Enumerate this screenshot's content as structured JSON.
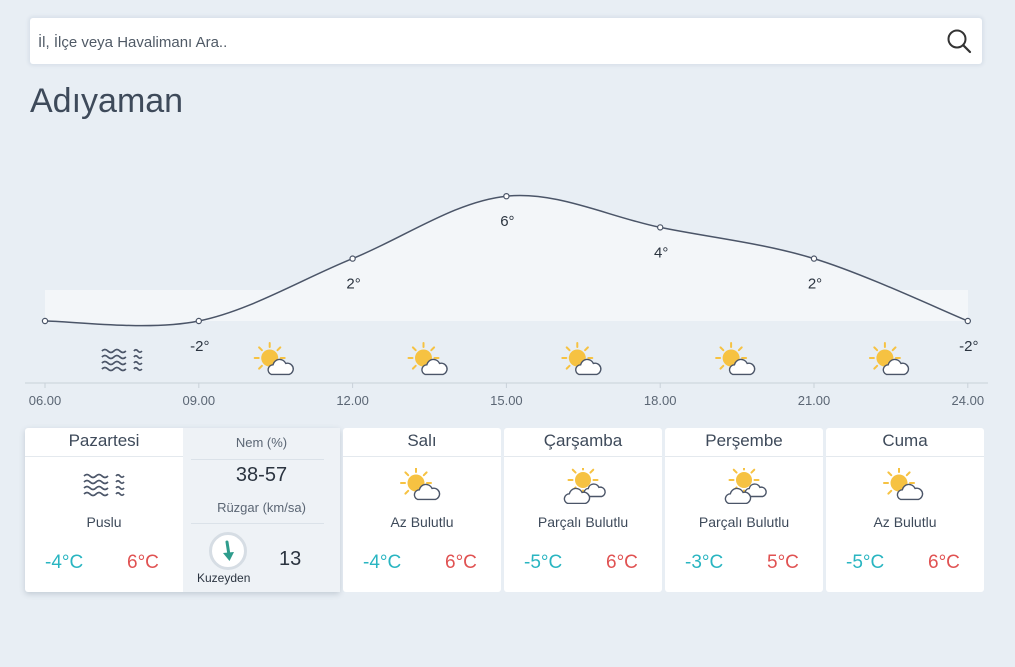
{
  "search": {
    "placeholder": "İl, İlçe veya Havalimanı Ara.."
  },
  "city": "Adıyaman",
  "chart_data": {
    "type": "line",
    "x": [
      "06.00",
      "09.00",
      "12.00",
      "15.00",
      "18.00",
      "21.00",
      "24.00"
    ],
    "values": [
      -2,
      -2,
      2,
      6,
      4,
      2,
      -2
    ],
    "value_labels": [
      "",
      "-2°",
      "2°",
      "6°",
      "4°",
      "2°",
      "-2°"
    ],
    "interval_icons": [
      "fog-icon",
      "partly-cloudy-icon",
      "partly-cloudy-icon",
      "partly-cloudy-icon",
      "partly-cloudy-icon",
      "partly-cloudy-icon"
    ],
    "colors": {
      "line": "#4b5568",
      "fill": "#f3f6f9",
      "sun": "#f6c242"
    }
  },
  "today": {
    "day": "Pazartesi",
    "icon": "fog-icon",
    "condition": "Puslu",
    "min": "-4°C",
    "max": "6°C",
    "humidity_label": "Nem (%)",
    "humidity": "38-57",
    "wind_label": "Rüzgar (km/sa)",
    "wind_direction": "Kuzeyden",
    "wind_speed": "13"
  },
  "forecast": [
    {
      "day": "Salı",
      "icon": "partly-cloudy-icon",
      "condition": "Az Bulutlu",
      "min": "-4°C",
      "max": "6°C"
    },
    {
      "day": "Çarşamba",
      "icon": "mostly-cloudy-icon",
      "condition": "Parçalı Bulutlu",
      "min": "-5°C",
      "max": "6°C"
    },
    {
      "day": "Perşembe",
      "icon": "mostly-cloudy-icon",
      "condition": "Parçalı Bulutlu",
      "min": "-3°C",
      "max": "5°C"
    },
    {
      "day": "Cuma",
      "icon": "partly-cloudy-icon",
      "condition": "Az Bulutlu",
      "min": "-5°C",
      "max": "6°C"
    }
  ],
  "colors": {
    "min_temp": "#29b5c1",
    "max_temp": "#e05252",
    "background": "#e8eef4"
  }
}
